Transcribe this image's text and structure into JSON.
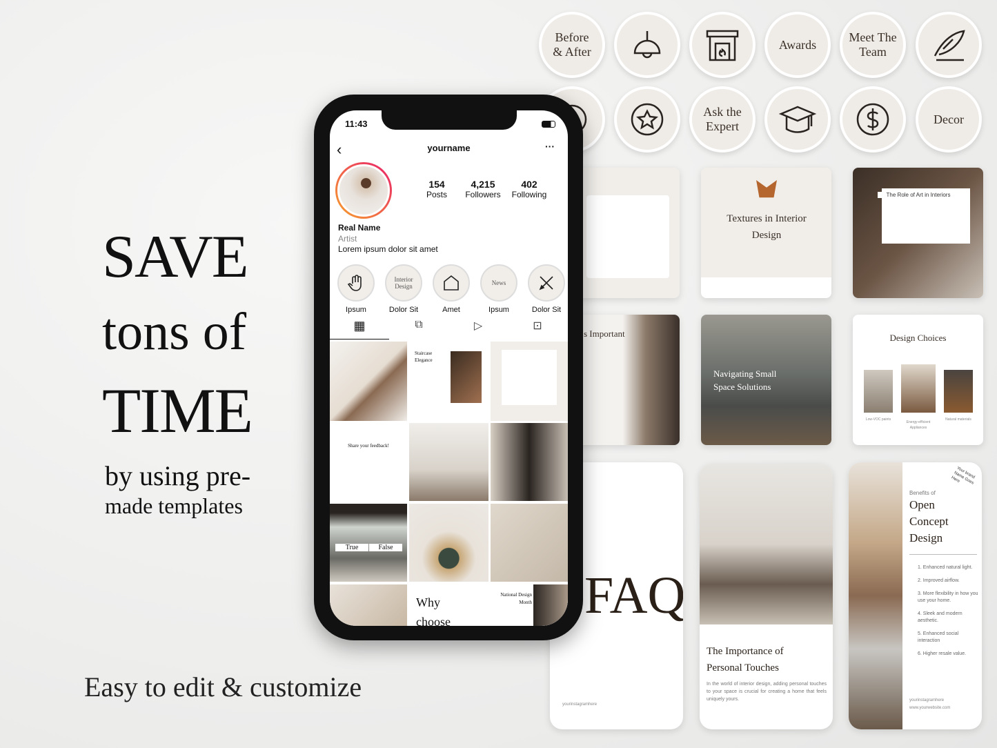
{
  "headline": {
    "line1": "SAVE",
    "line2": "tons of",
    "line3": "TIME",
    "line4": "by using pre-",
    "line5": "made templates"
  },
  "tagline": "Easy to edit & customize",
  "highlight_covers": [
    {
      "label": "Before & After",
      "icon": null
    },
    {
      "label": "",
      "icon": "pendant-lamp-icon"
    },
    {
      "label": "",
      "icon": "fireplace-icon"
    },
    {
      "label": "Awards",
      "icon": null
    },
    {
      "label": "Meet The Team",
      "icon": null
    },
    {
      "label": "",
      "icon": "feather-pen-icon"
    },
    {
      "label": "",
      "icon": "smiley-icon"
    },
    {
      "label": "",
      "icon": "star-icon"
    },
    {
      "label": "Ask the Expert",
      "icon": null
    },
    {
      "label": "",
      "icon": "graduation-cap-icon"
    },
    {
      "label": "",
      "icon": "dollar-icon"
    },
    {
      "label": "Decor",
      "icon": null
    }
  ],
  "phone": {
    "time": "11:43",
    "username": "yourname",
    "stats": [
      {
        "value": "154",
        "label": "Posts"
      },
      {
        "value": "4,215",
        "label": "Followers"
      },
      {
        "value": "402",
        "label": "Following"
      }
    ],
    "name": "Real Name",
    "category": "Artist",
    "bio": "Lorem ipsum dolor sit amet",
    "highlights": [
      {
        "label": "Ipsum",
        "cover": "",
        "icon": "hand-icon"
      },
      {
        "label": "Dolor Sit",
        "cover": "Interior Design",
        "icon": null
      },
      {
        "label": "Amet",
        "cover": "",
        "icon": "house-icon"
      },
      {
        "label": "Ipsum",
        "cover": "News",
        "icon": null
      },
      {
        "label": "Dolor Sit",
        "cover": "",
        "icon": "tools-icon"
      }
    ],
    "posts": {
      "staircase": "Staircase Elegance",
      "feedback": "Share your feedback!",
      "true_label": "True",
      "false_label": "False",
      "why": "Why choose",
      "national": "National Design Month"
    }
  },
  "cards": {
    "textures_title": "Textures in Interior Design",
    "art_title": "The Role of Art in Interiors",
    "important": "s Important",
    "navigating": "Navigating Small Space Solutions",
    "eco_title": "Design Choices",
    "eco_captions": [
      "Low-VOC paints",
      "Energy-efficient Appliances",
      "Natural materials"
    ],
    "faq": "FAQ",
    "faq_handle": "yourinstagramhere",
    "personal_title": "The Importance of Personal Touches",
    "personal_body": "In the world of interior design, adding personal touches to your space is crucial for creating a home that feels uniquely yours.",
    "open_kicker": "Benefits of",
    "open_title": "Open Concept Design",
    "open_brand": "Your brand Name Goes Here",
    "open_list": [
      "1. Enhanced natural light.",
      "2. Improved airflow.",
      "3. More flexibility in how you use your home.",
      "4. Sleek and modern aesthetic.",
      "5. Enhanced social interaction",
      "6. Higher resale value."
    ],
    "open_handle": "yourinstagramhere",
    "open_site": "www.yourwebsite.com"
  }
}
